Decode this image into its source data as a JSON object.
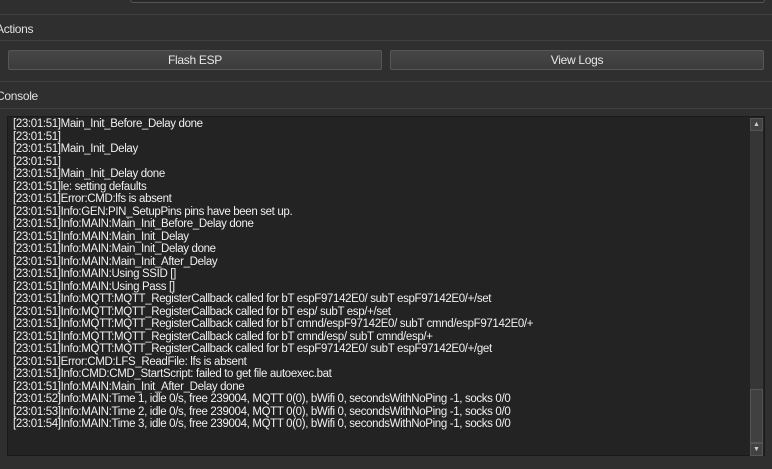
{
  "sections": {
    "actions": "Actions",
    "console": "Console"
  },
  "buttons": {
    "flash": "Flash ESP",
    "view_logs": "View Logs"
  },
  "console": {
    "lines": [
      "[23:01:51]Main_Init_Before_Delay done",
      "[23:01:51]",
      "[23:01:51]Main_Init_Delay",
      "[23:01:51]",
      "[23:01:51]Main_Init_Delay done",
      "[23:01:51]le: setting defaults",
      "[23:01:51]Error:CMD:lfs is absent",
      "[23:01:51]Info:GEN:PIN_SetupPins pins have been set up.",
      "[23:01:51]Info:MAIN:Main_Init_Before_Delay done",
      "[23:01:51]Info:MAIN:Main_Init_Delay",
      "[23:01:51]Info:MAIN:Main_Init_Delay done",
      "[23:01:51]Info:MAIN:Main_Init_After_Delay",
      "[23:01:51]Info:MAIN:Using SSID []",
      "[23:01:51]Info:MAIN:Using Pass []",
      "[23:01:51]Info:MQTT:MQTT_RegisterCallback called for bT espF97142E0/ subT espF97142E0/+/set",
      "[23:01:51]Info:MQTT:MQTT_RegisterCallback called for bT esp/ subT esp/+/set",
      "[23:01:51]Info:MQTT:MQTT_RegisterCallback called for bT cmnd/espF97142E0/ subT cmnd/espF97142E0/+",
      "[23:01:51]Info:MQTT:MQTT_RegisterCallback called for bT cmnd/esp/ subT cmnd/esp/+",
      "[23:01:51]Info:MQTT:MQTT_RegisterCallback called for bT espF97142E0/ subT espF97142E0/+/get",
      "[23:01:51]Error:CMD:LFS_ReadFile: lfs is absent",
      "[23:01:51]Info:CMD:CMD_StartScript: failed to get file autoexec.bat",
      "[23:01:51]Info:MAIN:Main_Init_After_Delay done",
      "[23:01:52]Info:MAIN:Time 1, idle 0/s, free 239004, MQTT 0(0), bWifi 0, secondsWithNoPing -1, socks 0/0",
      "[23:01:53]Info:MAIN:Time 2, idle 0/s, free 239004, MQTT 0(0), bWifi 0, secondsWithNoPing -1, socks 0/0",
      "[23:01:54]Info:MAIN:Time 3, idle 0/s, free 239004, MQTT 0(0), bWifi 0, secondsWithNoPing -1, socks 0/0"
    ]
  },
  "scrollbar": {
    "position_fraction": 1.0
  }
}
